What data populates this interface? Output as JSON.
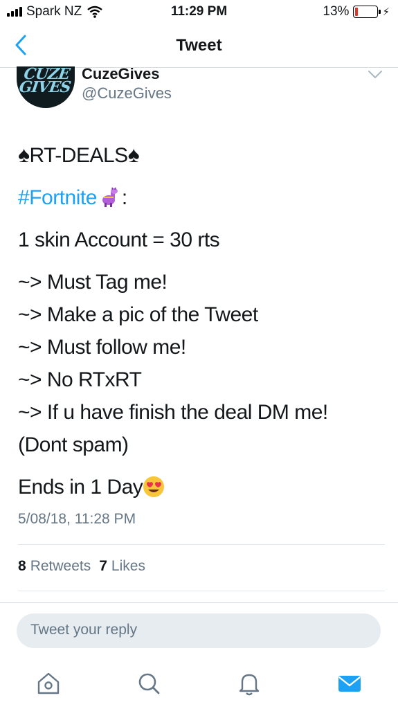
{
  "status_bar": {
    "carrier": "Spark NZ",
    "time": "11:29 PM",
    "battery": "13%",
    "battery_level": 0.13
  },
  "nav": {
    "title": "Tweet"
  },
  "tweet": {
    "avatar_text": "CUZE GIVES",
    "display_name": "CuzeGives",
    "handle": "@CuzeGives",
    "title_line": "RT-DEALS",
    "hashtag": "#Fortnite",
    "hashtag_suffix": ":",
    "offer": "1 skin Account = 30 rts",
    "rules": [
      "~> Must Tag me!",
      "~> Make a pic of the Tweet",
      "~> Must follow me!",
      "~> No RTxRT",
      "~> If u have finish the deal DM me!"
    ],
    "note": "(Dont spam)",
    "ends": "Ends in 1 Day",
    "timestamp": "5/08/18, 11:28 PM",
    "retweets_count": "8",
    "retweets_label": "Retweets",
    "likes_count": "7",
    "likes_label": "Likes"
  },
  "reply": {
    "placeholder": "Tweet your reply"
  },
  "icons": {
    "back": "chevron-left-icon",
    "more": "chevron-down-icon",
    "spade": "spade-icon",
    "llama": "llama-emoji",
    "heart_eyes": "heart-eyes-emoji",
    "home": "home-icon",
    "search": "search-icon",
    "notifications": "bell-icon",
    "messages": "mail-icon"
  },
  "colors": {
    "accent": "#1da1f2",
    "muted": "#657786",
    "battery_low": "#e0342c"
  }
}
